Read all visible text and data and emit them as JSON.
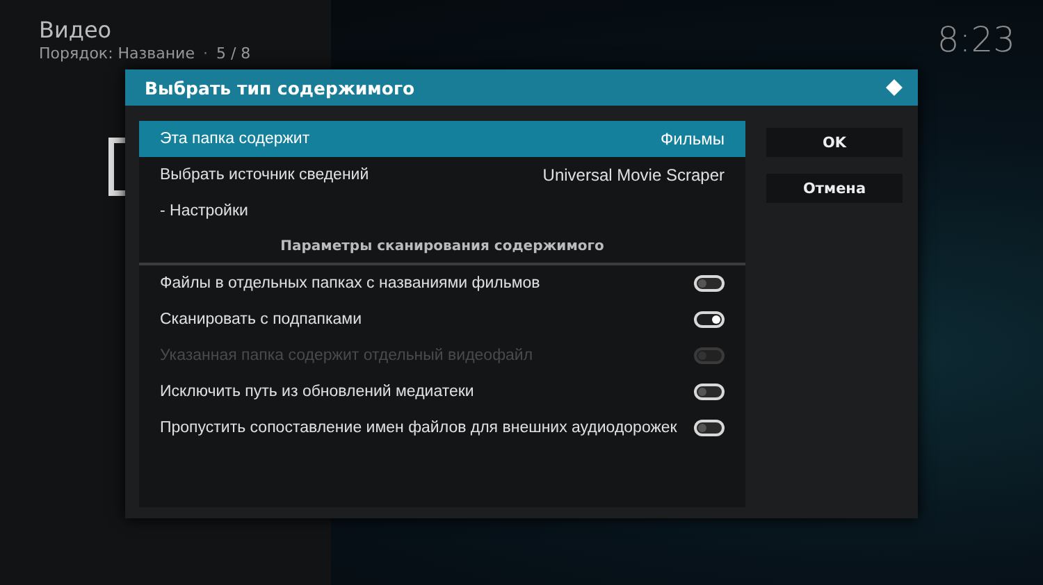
{
  "header": {
    "title": "Видео",
    "subtitle": "Порядок: Название",
    "separator": "·",
    "counter": "5 / 8",
    "clock": "8:23"
  },
  "dialog": {
    "title": "Выбрать тип содержимого",
    "items": [
      {
        "kind": "value",
        "label": "Эта папка содержит",
        "value": "Фильмы",
        "selected": true
      },
      {
        "kind": "value",
        "label": "Выбрать источник сведений",
        "value": "Universal Movie Scraper",
        "selected": false
      },
      {
        "kind": "action",
        "label": "- Настройки",
        "selected": false
      },
      {
        "kind": "header",
        "label": "Параметры сканирования содержимого"
      },
      {
        "kind": "toggle",
        "label": "Файлы в отдельных папках с названиями фильмов",
        "on": false,
        "disabled": false,
        "selected": false
      },
      {
        "kind": "toggle",
        "label": "Сканировать с подпапками",
        "on": true,
        "disabled": false,
        "selected": false
      },
      {
        "kind": "toggle",
        "label": "Указанная папка содержит отдельный видеофайл",
        "on": false,
        "disabled": true,
        "selected": false
      },
      {
        "kind": "toggle",
        "label": "Исключить путь из обновлений медиатеки",
        "on": false,
        "disabled": false,
        "selected": false
      },
      {
        "kind": "toggle",
        "label": "Пропустить сопоставление имен файлов для внешних аудиодорожек",
        "on": false,
        "disabled": false,
        "selected": false
      }
    ],
    "buttons": [
      {
        "label": "OK",
        "selected": false
      },
      {
        "label": "Отмена",
        "selected": false
      }
    ]
  }
}
